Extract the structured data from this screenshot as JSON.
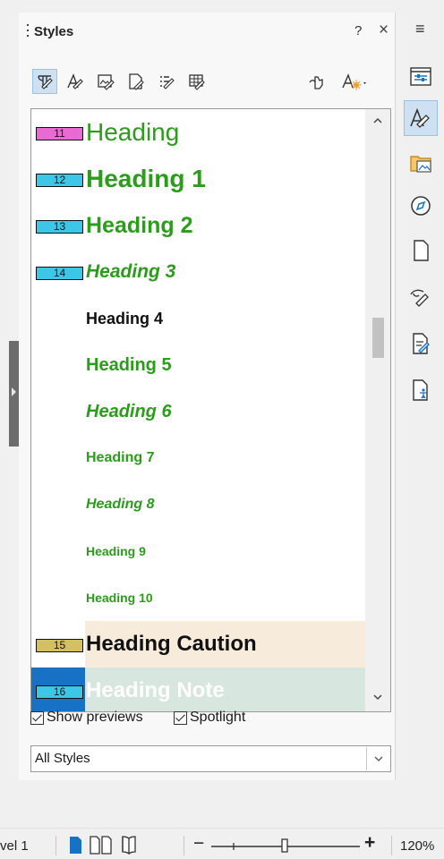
{
  "panel": {
    "title": "Styles",
    "help": "?",
    "close": "×",
    "menu": "≡"
  },
  "toolbar": {
    "buttons": [
      {
        "name": "paragraph-styles",
        "icon": "paragraph-style-icon",
        "active": true
      },
      {
        "name": "character-styles",
        "icon": "character-style-icon",
        "active": false
      },
      {
        "name": "frame-styles",
        "icon": "frame-style-icon",
        "active": false
      },
      {
        "name": "page-styles",
        "icon": "page-style-icon",
        "active": false
      },
      {
        "name": "list-styles",
        "icon": "list-style-icon",
        "active": false
      },
      {
        "name": "table-styles",
        "icon": "table-style-icon",
        "active": false
      },
      {
        "name": "fill-format-mode",
        "icon": "fill-format-icon",
        "active": false
      },
      {
        "name": "new-style-menu",
        "icon": "new-style-icon",
        "active": false
      }
    ]
  },
  "styles_list": [
    {
      "badge": "11",
      "badge_color": "#e86ad2",
      "label": "Heading",
      "color": "#2a9d1a",
      "size": 28,
      "bold": false,
      "italic": false
    },
    {
      "badge": "12",
      "badge_color": "#3dc7e6",
      "label": "Heading 1",
      "color": "#2a9d1a",
      "size": 28,
      "bold": true,
      "italic": false
    },
    {
      "badge": "13",
      "badge_color": "#3dc7e6",
      "label": "Heading 2",
      "color": "#2a9d1a",
      "size": 25,
      "bold": true,
      "italic": false
    },
    {
      "badge": "14",
      "badge_color": "#3dc7e6",
      "label": "Heading 3",
      "color": "#2a9d1a",
      "size": 21,
      "bold": true,
      "italic": true
    },
    {
      "badge": "",
      "badge_color": "",
      "label": "Heading 4",
      "color": "#111111",
      "size": 18,
      "bold": true,
      "italic": false
    },
    {
      "badge": "",
      "badge_color": "",
      "label": "Heading 5",
      "color": "#2a9d1a",
      "size": 20,
      "bold": true,
      "italic": false
    },
    {
      "badge": "",
      "badge_color": "",
      "label": "Heading 6",
      "color": "#2a9d1a",
      "size": 20,
      "bold": true,
      "italic": true
    },
    {
      "badge": "",
      "badge_color": "",
      "label": "Heading 7",
      "color": "#2a9d1a",
      "size": 16,
      "bold": true,
      "italic": false
    },
    {
      "badge": "",
      "badge_color": "",
      "label": "Heading 8",
      "color": "#2a9d1a",
      "size": 16,
      "bold": true,
      "italic": true
    },
    {
      "badge": "",
      "badge_color": "",
      "label": "Heading 9",
      "color": "#2a9d1a",
      "size": 14,
      "bold": true,
      "italic": false
    },
    {
      "badge": "",
      "badge_color": "",
      "label": "Heading 10",
      "color": "#2a9d1a",
      "size": 14,
      "bold": true,
      "italic": false
    },
    {
      "badge": "15",
      "badge_color": "#d4c060",
      "label": "Heading Caution",
      "color": "#111111",
      "size": 24,
      "bold": true,
      "italic": false,
      "bg": "#f7ebdc"
    },
    {
      "badge": "16",
      "badge_color": "#3dc7e6",
      "label": "Heading Note",
      "color": "#ffffff",
      "size": 24,
      "bold": true,
      "italic": false,
      "bg": "#d8e6e0",
      "badge_bg": "#1772c6"
    }
  ],
  "options": {
    "show_previews": "Show previews",
    "spotlight": "Spotlight"
  },
  "filter": {
    "value": "All Styles"
  },
  "sidebar": {
    "buttons": [
      {
        "name": "properties",
        "icon": "properties-icon"
      },
      {
        "name": "styles",
        "icon": "styles-icon",
        "active": true
      },
      {
        "name": "gallery",
        "icon": "gallery-icon"
      },
      {
        "name": "navigator",
        "icon": "navigator-icon"
      },
      {
        "name": "page",
        "icon": "page-icon"
      },
      {
        "name": "style-inspector",
        "icon": "style-inspector-icon"
      },
      {
        "name": "manage-changes",
        "icon": "manage-changes-icon"
      },
      {
        "name": "accessibility-check",
        "icon": "accessibility-check-icon"
      }
    ]
  },
  "statusbar": {
    "outline_level": "vel 1",
    "zoom": "120%",
    "zoom_minus": "−",
    "zoom_plus": "+"
  },
  "colors": {
    "accent": "#1772c6",
    "active_bg": "#cde1f3",
    "heading_green": "#2a9d1a"
  }
}
